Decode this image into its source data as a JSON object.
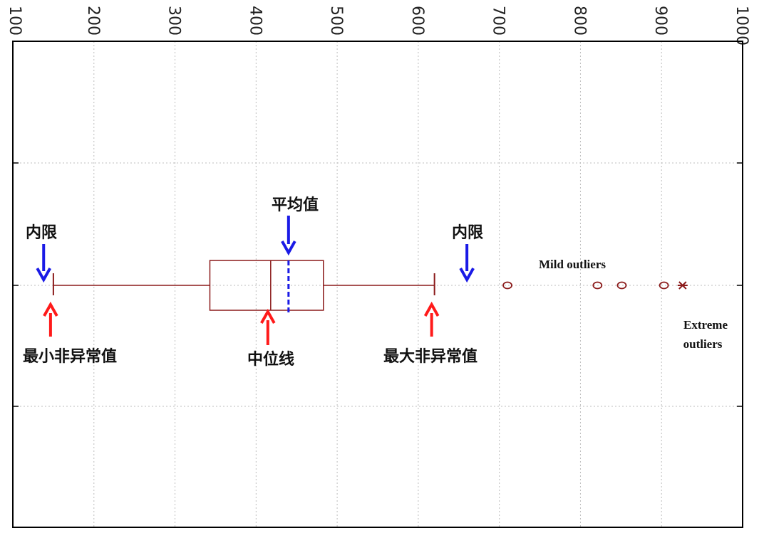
{
  "chart_data": {
    "type": "boxplot",
    "x_ticks": [
      "100",
      "200",
      "300",
      "400",
      "500",
      "600",
      "700",
      "800",
      "900",
      "1000"
    ],
    "xlim": [
      100,
      1000
    ],
    "grid": true,
    "box": {
      "lower_whisker": 150,
      "q1": 343,
      "median": 418,
      "mean": 440,
      "q3": 483,
      "upper_whisker": 620
    },
    "inner_fences": [
      138,
      660
    ],
    "mild_outliers": [
      710,
      821,
      851,
      903
    ],
    "extreme_outliers": [
      926
    ],
    "annotations": {
      "inner_fence_left": "内限",
      "inner_fence_right": "内限",
      "mean": "平均值",
      "min_nonoutlier": "最小非异常值",
      "median": "中位线",
      "max_nonoutlier": "最大非异常值",
      "mild_outliers": "Mild outliers",
      "extreme_outliers_line1": "Extreme",
      "extreme_outliers_line2": "outliers"
    },
    "colors": {
      "box": "#8b1a1a",
      "mean_line": "#1a1ae6",
      "up_arrow": "#ff1a1a",
      "down_arrow": "#1a1ae6",
      "grid": "#bdbdbd"
    }
  }
}
